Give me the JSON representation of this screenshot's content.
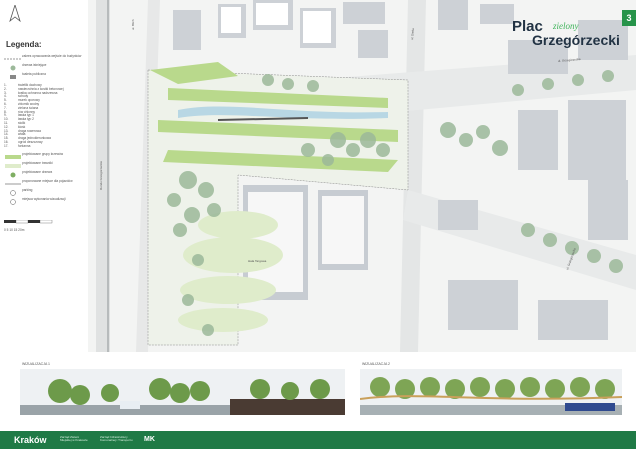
{
  "legend": {
    "title": "Legenda:",
    "symbols": [
      {
        "label": "zakres opracowania wejście do budynków"
      },
      {
        "label": "drzewa istniejące"
      },
      {
        "label": "toaleta publiczna"
      }
    ],
    "numbered": [
      {
        "n": "1.",
        "label": "świetlik dachowy"
      },
      {
        "n": "2.",
        "label": "nawierzchnia z kostki betonowej"
      },
      {
        "n": "3.",
        "label": "kratka ochronna nadrzewna"
      },
      {
        "n": "4.",
        "label": "schody"
      },
      {
        "n": "5.",
        "label": "murek oporowy"
      },
      {
        "n": "6.",
        "label": "zbiornik wodny"
      },
      {
        "n": "7.",
        "label": "zielona ściana"
      },
      {
        "n": "8.",
        "label": "rów chłonny"
      },
      {
        "n": "9.",
        "label": "ławka typ 1"
      },
      {
        "n": "10.",
        "label": "ławka typ 2"
      },
      {
        "n": "11.",
        "label": "stolik"
      },
      {
        "n": "12.",
        "label": "kiosk"
      },
      {
        "n": "13.",
        "label": "droga rowerowa"
      },
      {
        "n": "14.",
        "label": "wiata"
      },
      {
        "n": "15.",
        "label": "droga jednokierunkowa"
      },
      {
        "n": "16.",
        "label": "ogród deszczowy"
      },
      {
        "n": "17.",
        "label": "fontanna"
      }
    ],
    "areas": [
      {
        "label": "projektowane grupy krzewów"
      },
      {
        "label": "projektowane trawniki"
      },
      {
        "label": "projektowane drzewa"
      },
      {
        "label": "proponowane miejsce dla pojazdów"
      },
      {
        "label": "parking"
      },
      {
        "label": "miejsca wykonania wizualizacji"
      }
    ],
    "scale_label": "0  5  10  15  20m"
  },
  "title": {
    "top": "Plac",
    "accent": "zielony",
    "main": "Grzegórzecki"
  },
  "page_number": "3",
  "streets": {
    "left": "Rondo Grzegórzeckie",
    "upper": "ul. Grzegórzecka",
    "right": "ul. Grzegórzecka",
    "vertical": "ul. Blich",
    "lower_left": "ul. Ks. Wincentego Smoczyńskiego",
    "lower_mid": "ul. Rzeźnicza",
    "lower_right": "ul. Grzegórzecka",
    "top_mid": "ul. Dietla"
  },
  "labels": {
    "building": "Hala Targowa",
    "placeholder": "ul. Grzegórzecka"
  },
  "visualizations": [
    {
      "label": "WIZUALIZACJA 1"
    },
    {
      "label": "WIZUALIZACJA 2"
    }
  ],
  "footer": {
    "brand": "Kraków",
    "logo1": "Zarząd Zieleni Miejskiej w Krakowie",
    "logo2": "Zarząd Infrastruktury Komunalnej i Transportu",
    "logo3": "MK"
  },
  "colors": {
    "accent": "#27944a",
    "footer": "#1f7a46",
    "title": "#223344"
  }
}
